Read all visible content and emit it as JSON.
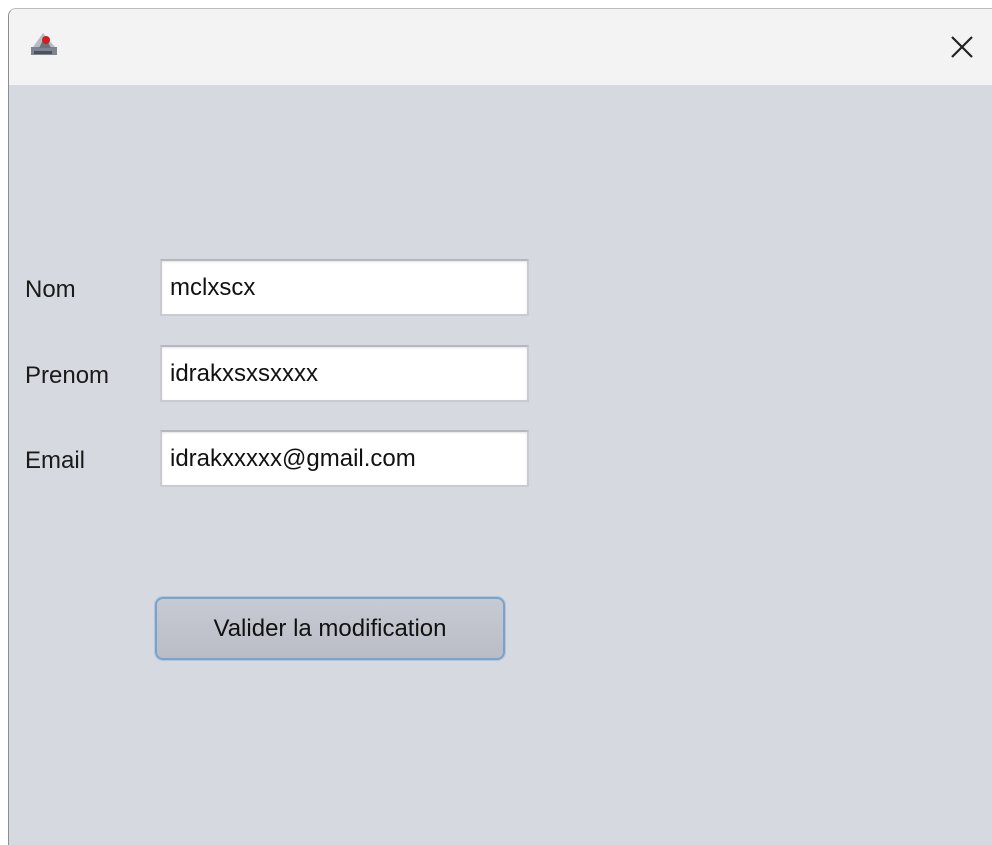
{
  "window": {
    "icon": "java-app-icon",
    "close_icon": "close-icon"
  },
  "form": {
    "nom": {
      "label": "Nom",
      "value": "mclxscx"
    },
    "prenom": {
      "label": "Prenom",
      "value": "idrakxsxsxxxx"
    },
    "email": {
      "label": "Email",
      "value": "idrakxxxxx@gmail.com"
    }
  },
  "actions": {
    "submit_label": "Valider la modification"
  }
}
